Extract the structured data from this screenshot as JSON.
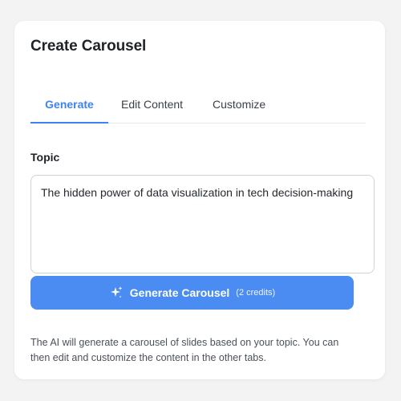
{
  "card": {
    "title": "Create Carousel"
  },
  "tabs": [
    {
      "label": "Generate",
      "active": true
    },
    {
      "label": "Edit Content",
      "active": false
    },
    {
      "label": "Customize",
      "active": false
    }
  ],
  "topic": {
    "label": "Topic",
    "value": "The hidden power of data visualization in tech decision-making"
  },
  "generate_button": {
    "icon": "sparkle-icon",
    "label": "Generate Carousel",
    "credits": "(2 credits)"
  },
  "hint": "The AI will generate a carousel of slides based on your topic. You can then edit and customize the content in the other tabs.",
  "colors": {
    "accent": "#3f83f0",
    "button": "#4a8cf2",
    "background": "#f3f3f4"
  }
}
